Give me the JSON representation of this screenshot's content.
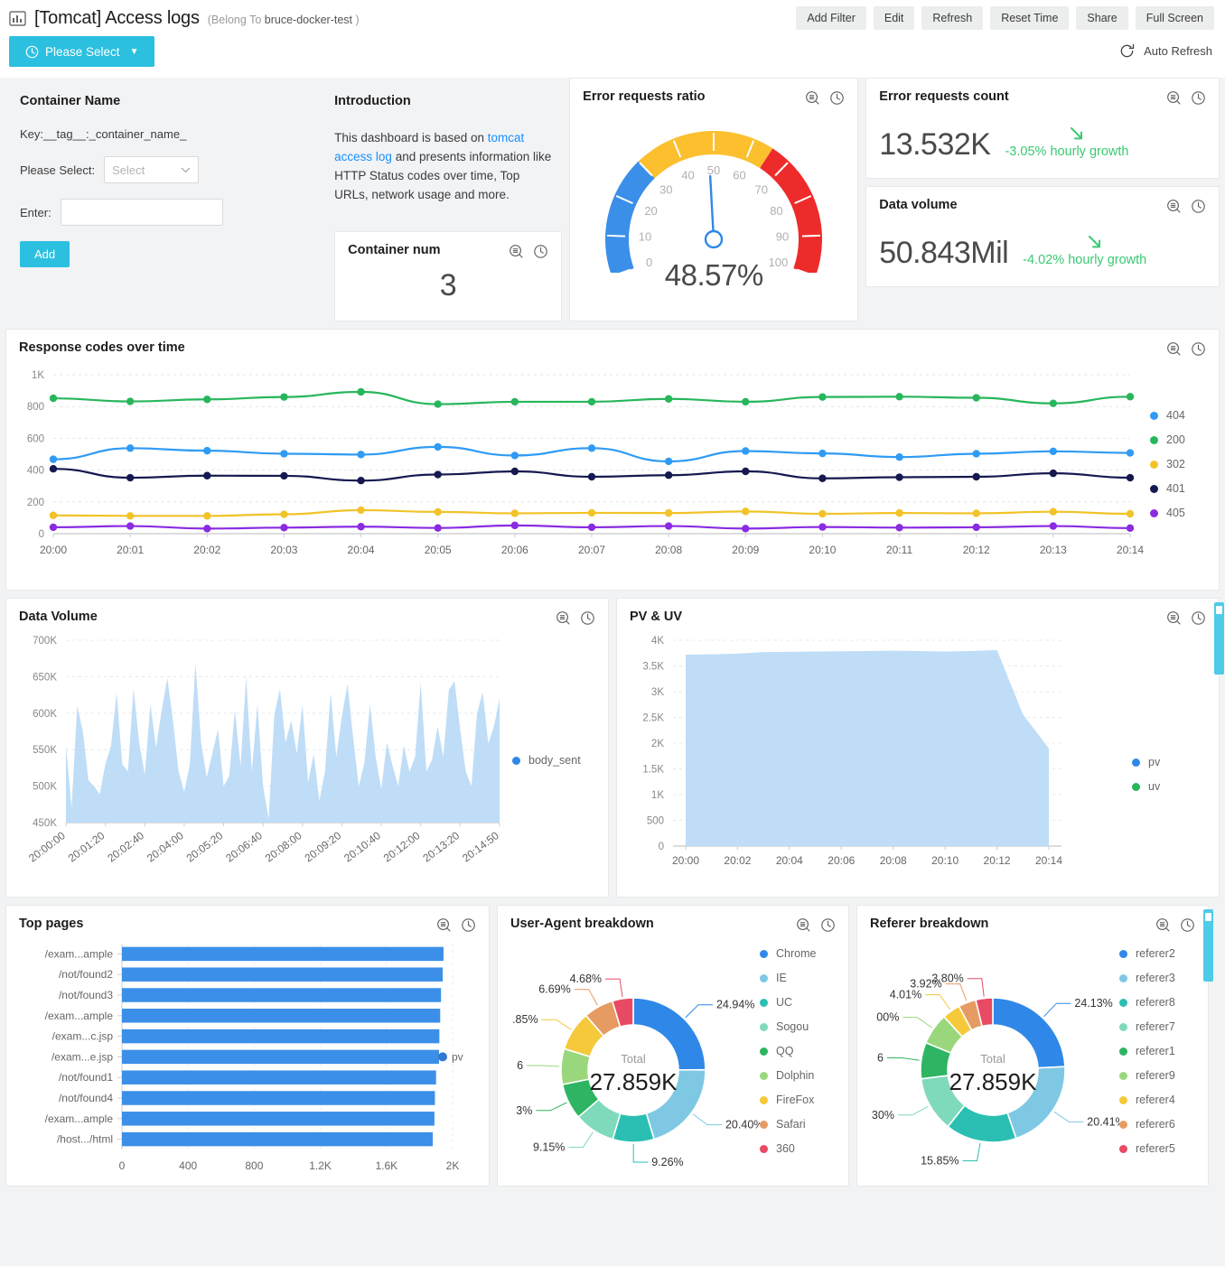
{
  "header": {
    "icon": "dashboard-icon",
    "title": "[Tomcat] Access logs",
    "belong_prefix": "(Belong To ",
    "belong_value": "bruce-docker-test",
    "belong_suffix": " )",
    "buttons": [
      "Add Filter",
      "Edit",
      "Refresh",
      "Reset Time",
      "Share",
      "Full Screen"
    ],
    "time_picker": "Please Select",
    "auto_refresh": "Auto Refresh"
  },
  "filter_panel": {
    "title": "Container Name",
    "key_text": "Key:__tag__:_container_name_",
    "select_label": "Please Select:",
    "select_value": "Select",
    "enter_label": "Enter:",
    "enter_value": "",
    "enter_placeholder": "",
    "add_button": "Add"
  },
  "introduction": {
    "title": "Introduction",
    "text_before": "This dashboard is based on ",
    "link": "tomcat access log",
    "text_after": " and presents information like HTTP Status codes over time, Top URLs, network usage and more."
  },
  "container_num": {
    "title": "Container num",
    "value": "3"
  },
  "error_ratio": {
    "title": "Error requests ratio",
    "value_label": "48.57%"
  },
  "error_count": {
    "title": "Error requests count",
    "value": "13.532K",
    "growth": "-3.05% hourly growth",
    "growth_color": "#3ac973"
  },
  "data_volume_metric": {
    "title": "Data volume",
    "value": "50.843Mil",
    "growth": "-4.02% hourly growth",
    "growth_color": "#3ac973"
  },
  "cards": {
    "response_codes": "Response codes over time",
    "data_volume": "Data Volume",
    "pv_uv": "PV & UV",
    "top_pages": "Top pages",
    "ua_breakdown": "User-Agent breakdown",
    "referer_breakdown": "Referer breakdown"
  },
  "chart_data": [
    {
      "id": "error_requests_ratio",
      "type": "gauge",
      "title": "Error requests ratio",
      "value": 48.57,
      "value_label": "48.57%",
      "min": 0,
      "max": 100,
      "ticks": [
        0,
        10,
        20,
        30,
        40,
        50,
        60,
        70,
        80,
        90,
        100
      ],
      "bands": [
        {
          "from": 0,
          "to": 30,
          "color": "#3b8fe8"
        },
        {
          "from": 30,
          "to": 65,
          "color": "#fcbf2e"
        },
        {
          "from": 65,
          "to": 100,
          "color": "#ee2b2b"
        }
      ]
    },
    {
      "id": "response_codes_over_time",
      "type": "line",
      "title": "Response codes over time",
      "xlabel": "",
      "ylabel": "",
      "ylim": [
        0,
        1000
      ],
      "yticks": [
        0,
        200,
        400,
        600,
        800,
        1000
      ],
      "ytick_labels": [
        "0",
        "200",
        "400",
        "600",
        "800",
        "1K"
      ],
      "grid": true,
      "legend_position": "right",
      "x": [
        "20:00",
        "20:01",
        "20:02",
        "20:03",
        "20:04",
        "20:05",
        "20:06",
        "20:07",
        "20:08",
        "20:09",
        "20:10",
        "20:11",
        "20:12",
        "20:13",
        "20:14"
      ],
      "series": [
        {
          "name": "404",
          "color": "#2f9bf5",
          "values": [
            468,
            538,
            522,
            503,
            498,
            546,
            492,
            538,
            455,
            520,
            505,
            482,
            503,
            518,
            508
          ]
        },
        {
          "name": "200",
          "color": "#27b65b",
          "values": [
            852,
            832,
            845,
            860,
            892,
            815,
            830,
            830,
            848,
            830,
            860,
            862,
            855,
            820,
            862
          ]
        },
        {
          "name": "302",
          "color": "#f2c329",
          "values": [
            115,
            112,
            112,
            122,
            148,
            137,
            128,
            131,
            130,
            140,
            125,
            130,
            128,
            138,
            125
          ]
        },
        {
          "name": "401",
          "color": "#16194f",
          "values": [
            408,
            352,
            365,
            364,
            334,
            372,
            392,
            358,
            368,
            392,
            348,
            355,
            358,
            380,
            352
          ]
        },
        {
          "name": "405",
          "color": "#8a2be2",
          "values": [
            40,
            48,
            32,
            38,
            44,
            36,
            52,
            40,
            48,
            32,
            42,
            38,
            40,
            48,
            35
          ]
        }
      ]
    },
    {
      "id": "data_volume_area",
      "type": "area",
      "title": "Data Volume",
      "ylim": [
        450000,
        700000
      ],
      "yticks": [
        450000,
        500000,
        550000,
        600000,
        650000,
        700000
      ],
      "ytick_labels": [
        "450K",
        "500K",
        "550K",
        "600K",
        "650K",
        "700K"
      ],
      "xtick_labels": [
        "20:00:00",
        "20:01:20",
        "20:02:40",
        "20:04:00",
        "20:05:20",
        "20:06:40",
        "20:08:00",
        "20:09:20",
        "20:10:40",
        "20:12:00",
        "20:13:20",
        "20:14:50"
      ],
      "legend": [
        "body_sent"
      ],
      "legend_colors": [
        "#2f88e8"
      ],
      "series_color": "#bcdbf7",
      "values": [
        556000,
        470000,
        610000,
        575000,
        508000,
        500000,
        489000,
        530000,
        555000,
        628000,
        530000,
        520000,
        634000,
        560000,
        516000,
        612000,
        553000,
        604000,
        648000,
        590000,
        520000,
        492000,
        530000,
        668000,
        560000,
        512000,
        545000,
        578000,
        500000,
        514000,
        605000,
        527000,
        650000,
        520000,
        612000,
        500000,
        455000,
        598000,
        633000,
        560000,
        590000,
        545000,
        612000,
        505000,
        544000,
        480000,
        520000,
        628000,
        540000,
        596000,
        640000,
        566000,
        500000,
        532000,
        612000,
        540000,
        496000,
        560000,
        528000,
        500000,
        556000,
        520000,
        540000,
        642000,
        520000,
        536000,
        582000,
        540000,
        632000,
        644000,
        578000,
        520000,
        500000,
        600000,
        629000,
        558000,
        582000,
        620000
      ]
    },
    {
      "id": "pv_uv",
      "type": "area",
      "title": "PV & UV",
      "ylim": [
        0,
        4000
      ],
      "yticks": [
        0,
        500,
        1000,
        1500,
        2000,
        2500,
        3000,
        3500,
        4000
      ],
      "ytick_labels": [
        "0",
        "500",
        "1K",
        "1.5K",
        "2K",
        "2.5K",
        "3K",
        "3.5K",
        "4K"
      ],
      "xtick_labels": [
        "20:00",
        "20:02",
        "20:04",
        "20:06",
        "20:08",
        "20:10",
        "20:12",
        "20:14"
      ],
      "legend": [
        "pv",
        "uv"
      ],
      "legend_colors": [
        "#2f88e8",
        "#27b65b"
      ],
      "series_color": "#bcdbf7",
      "x": [
        "20:00",
        "20:01",
        "20:02",
        "20:03",
        "20:04",
        "20:05",
        "20:06",
        "20:07",
        "20:08",
        "20:09",
        "20:10",
        "20:11",
        "20:12",
        "20:13",
        "20:14"
      ],
      "pv": [
        3720,
        3725,
        3740,
        3770,
        3775,
        3780,
        3785,
        3790,
        3795,
        3790,
        3780,
        3790,
        3810,
        2560,
        1900
      ],
      "uv": [
        3720,
        3725,
        3740,
        3770,
        3775,
        3780,
        3785,
        3790,
        3795,
        3790,
        3780,
        3790,
        3810,
        2560,
        1900
      ]
    },
    {
      "id": "top_pages",
      "type": "bar",
      "orientation": "horizontal",
      "title": "Top pages",
      "xlim": [
        0,
        2000
      ],
      "xticks": [
        0,
        400,
        800,
        1200,
        1600,
        2000
      ],
      "xtick_labels": [
        "0",
        "400",
        "800",
        "1.2K",
        "1.6K",
        "2K"
      ],
      "legend": [
        "pv"
      ],
      "bar_color": "#3b8fe8",
      "categories": [
        "/exam...ample",
        "/not/found2",
        "/not/found3",
        "/exam...ample",
        "/exam...c.jsp",
        "/exam...e.jsp",
        "/not/found1",
        "/not/found4",
        "/exam...ample",
        "/host.../html"
      ],
      "values": [
        1945,
        1940,
        1930,
        1925,
        1920,
        1918,
        1900,
        1893,
        1890,
        1880
      ]
    },
    {
      "id": "ua_breakdown",
      "type": "pie",
      "title": "User-Agent breakdown",
      "center_label": "Total",
      "center_value": "27.859K",
      "legend_position": "right",
      "labels": [
        "Chrome",
        "IE",
        "UC",
        "Sogou",
        "QQ",
        "Dolphin",
        "FireFox",
        "Safari",
        "360"
      ],
      "values": [
        24.94,
        20.4,
        9.26,
        9.15,
        8.03,
        8.0,
        8.85,
        6.69,
        4.68
      ],
      "value_labels": [
        "24.94%",
        "20.40%",
        "9.26%",
        "9.15%",
        "3%",
        "6",
        ".85%",
        "6.69%",
        "4.68%"
      ],
      "colors": [
        "#2f88e8",
        "#7ec8e3",
        "#2bbfb3",
        "#7fd9bb",
        "#2eb563",
        "#9ad77c",
        "#f5c93a",
        "#e59b62",
        "#e84a63"
      ]
    },
    {
      "id": "referer_breakdown",
      "type": "pie",
      "title": "Referer breakdown",
      "center_label": "Total",
      "center_value": "27.859K",
      "legend_position": "right",
      "labels": [
        "referer2",
        "referer3",
        "referer8",
        "referer7",
        "referer1",
        "referer9",
        "referer4",
        "referer6",
        "referer5"
      ],
      "values": [
        24.13,
        20.41,
        15.85,
        12.3,
        8.06,
        7.0,
        4.01,
        3.92,
        3.8
      ],
      "value_labels": [
        "24.13%",
        "20.41%",
        "15.85%",
        "30%",
        "6",
        "00%",
        "4.01%",
        "3.92%",
        "3.80%"
      ],
      "colors": [
        "#2f88e8",
        "#7ec8e3",
        "#2bbfb3",
        "#7fd9bb",
        "#2eb563",
        "#9ad77c",
        "#f5c93a",
        "#e59b62",
        "#e84a63"
      ]
    }
  ]
}
